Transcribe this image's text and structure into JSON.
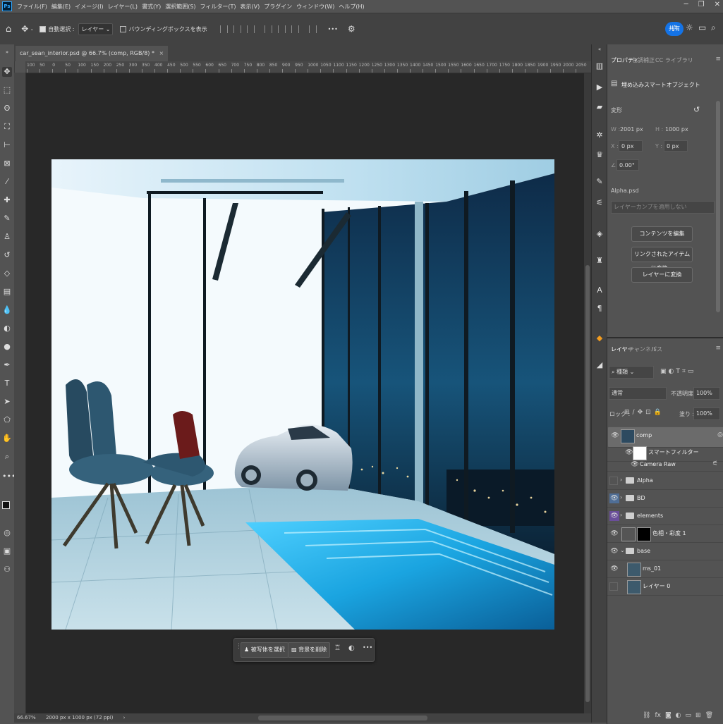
{
  "menu": {
    "app_icon": "Ps",
    "items": [
      "ファイル(F)",
      "編集(E)",
      "イメージ(I)",
      "レイヤー(L)",
      "書式(Y)",
      "選択範囲(S)",
      "フィルター(T)",
      "表示(V)",
      "プラグイン",
      "ウィンドウ(W)",
      "ヘルプ(H)"
    ],
    "window_controls": [
      "minimize",
      "restore",
      "close"
    ]
  },
  "options_bar": {
    "auto_select_label": "自動選択 :",
    "auto_select_checked": true,
    "auto_select_target": "レイヤー",
    "bounding_box_label": "バウンディングボックスを表示",
    "bounding_box_checked": false,
    "more": "•••",
    "share_label": "共有"
  },
  "document": {
    "tab_title": "car_sean_interior.psd @ 66.7% (comp, RGB/8) *",
    "close_glyph": "×",
    "ruler_labels": [
      "100",
      "50",
      "0",
      "50",
      "100",
      "150",
      "200",
      "250",
      "300",
      "350",
      "400",
      "450",
      "500",
      "550",
      "600",
      "650",
      "700",
      "750",
      "800",
      "850",
      "900",
      "950",
      "1000",
      "1050",
      "1100",
      "1150",
      "1200",
      "1250",
      "1300",
      "1350",
      "1400",
      "1450",
      "1500",
      "1550",
      "1600",
      "1650",
      "1700",
      "1750",
      "1800",
      "1850",
      "1900",
      "1950",
      "2000",
      "2050",
      "21"
    ]
  },
  "context_bar": {
    "select_subject": "被写体を選択",
    "remove_bg": "背景を削除",
    "more": "•••"
  },
  "status": {
    "zoom": "66.67%",
    "doc_size": "2000 px x 1000 px (72 ppi)"
  },
  "properties": {
    "tabs": [
      "プロパティ",
      "色調補正",
      "CC ライブラリ"
    ],
    "object_type": "埋め込みスマートオブジェクト",
    "transform_label": "変形",
    "w_label": "W :",
    "w_value": "2001 px",
    "h_label": "H :",
    "h_value": "1000 px",
    "x_label": "X :",
    "x_value": "0 px",
    "y_label": "Y :",
    "y_value": "0 px",
    "angle_value": "0.00°",
    "linked_file": "Alpha.psd",
    "comp_placeholder": "レイヤーカンプを適用しない",
    "edit_contents": "コンテンツを編集",
    "convert_linked": "リンクされたアイテムに変換...",
    "convert_layers": "レイヤーに変換"
  },
  "layers_panel": {
    "tabs": [
      "レイヤー",
      "チャンネル",
      "パス"
    ],
    "filter_kind": "種類",
    "blend_mode": "通常",
    "opacity_label": "不透明度 :",
    "opacity_value": "100%",
    "lock_label": "ロック :",
    "fill_label": "塗り :",
    "fill_value": "100%",
    "layers": [
      {
        "name": "comp",
        "kind": "smart-object",
        "visible": true,
        "selected": true
      },
      {
        "name": "スマートフィルター",
        "kind": "smart-filter-mask",
        "visible": true
      },
      {
        "name": "Camera Raw",
        "kind": "filter",
        "visible": true
      },
      {
        "name": "Alpha",
        "kind": "group",
        "visible": false
      },
      {
        "name": "BD",
        "kind": "group",
        "visible": true,
        "color": "#4f6e96"
      },
      {
        "name": "elements",
        "kind": "group",
        "visible": true,
        "color": "#6a4e9a"
      },
      {
        "name": "色相・彩度 1",
        "kind": "adjustment",
        "visible": true
      },
      {
        "name": "base",
        "kind": "group",
        "visible": true
      },
      {
        "name": "ms_01",
        "kind": "smart-object",
        "visible": true
      },
      {
        "name": "レイヤー 0",
        "kind": "pixel",
        "visible": false
      }
    ]
  }
}
